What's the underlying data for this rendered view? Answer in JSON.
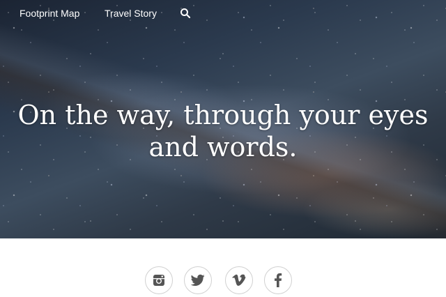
{
  "nav": {
    "items": [
      {
        "label": "Footprint Map"
      },
      {
        "label": "Travel Story"
      }
    ],
    "search_icon": "search-icon"
  },
  "hero": {
    "line1": "On the way, through your eyes",
    "line2": "and words."
  },
  "social": {
    "icon_color": "#555555",
    "items": [
      {
        "icon": "instagram-icon"
      },
      {
        "icon": "twitter-icon"
      },
      {
        "icon": "vimeo-icon"
      },
      {
        "icon": "facebook-icon"
      }
    ]
  }
}
